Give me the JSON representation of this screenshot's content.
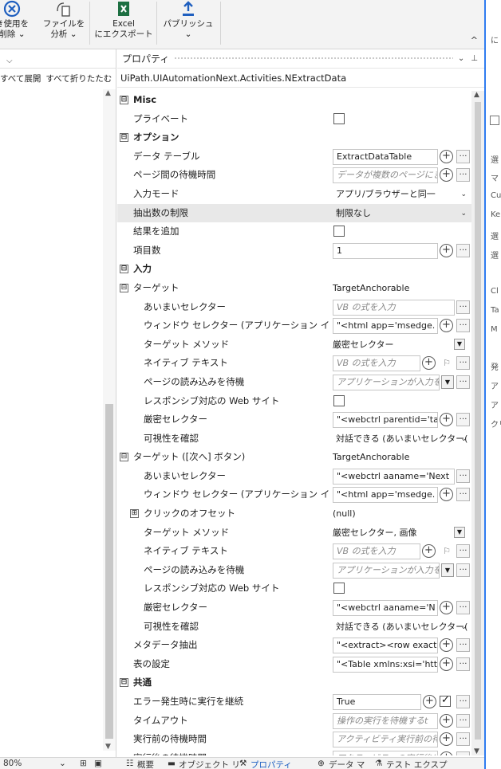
{
  "ribbon": {
    "btn1": {
      "icon": "close-circle-icon",
      "line1": "き使用を",
      "line2": "削除 ⌄"
    },
    "btn2": {
      "icon": "analyze-file-icon",
      "line1": "ファイルを",
      "line2": "分析 ⌄"
    },
    "btn3": {
      "icon": "excel-icon",
      "line1": "Excel",
      "line2": "にエクスポート"
    },
    "btn4": {
      "icon": "publish-icon",
      "line1": "パブリッシュ",
      "line2": "⌄"
    },
    "collapse": "^"
  },
  "left_panel": {
    "expand_all": "すべて展開",
    "collapse_all": "すべて折りたたむ"
  },
  "properties": {
    "title": "プロパティ",
    "activity": "UiPath.UIAutomationNext.Activities.NExtractData",
    "rows": [
      {
        "kind": "cat",
        "toggle": "⊟",
        "name": "Misc"
      },
      {
        "name": "プライベート",
        "value": {
          "type": "check",
          "checked": false
        }
      },
      {
        "kind": "cat",
        "toggle": "⊟",
        "name": "オプション"
      },
      {
        "name": "データ テーブル",
        "value": {
          "type": "text",
          "text": "ExtractDataTable",
          "add": true,
          "ell": true
        }
      },
      {
        "name": "ページ間の待機時間",
        "value": {
          "type": "text",
          "text": "データが複数のページにま",
          "ph": true,
          "add": true,
          "ell": true
        }
      },
      {
        "name": "入力モード",
        "value": {
          "type": "dropdown",
          "text": "アプリ/ブラウザーと同一"
        }
      },
      {
        "name": "抽出数の制限",
        "selected": true,
        "value": {
          "type": "dropdown",
          "text": "制限なし"
        }
      },
      {
        "name": "結果を追加",
        "value": {
          "type": "check",
          "checked": false
        }
      },
      {
        "name": "項目数",
        "value": {
          "type": "text",
          "text": "1",
          "add": true,
          "ell": true
        }
      },
      {
        "kind": "cat",
        "toggle": "⊟",
        "name": "入力"
      },
      {
        "kind": "sub",
        "toggle": "⊟",
        "name": "ターゲット",
        "value": {
          "type": "plain",
          "text": "TargetAnchorable"
        }
      },
      {
        "indent": 2,
        "name": "あいまいセレクター",
        "value": {
          "type": "text",
          "text": "VB の式を入力",
          "ph": true,
          "ell": true
        }
      },
      {
        "indent": 2,
        "name": "ウィンドウ セレクター (アプリケーション インスタン...",
        "value": {
          "type": "text",
          "text": "\"<html app='msedge.",
          "add": true,
          "ell": true
        }
      },
      {
        "indent": 2,
        "name": "ターゲット メソッド",
        "value": {
          "type": "plainsq",
          "text": "厳密セレクター"
        }
      },
      {
        "indent": 2,
        "name": "ネイティブ テキスト",
        "value": {
          "type": "text",
          "text": "VB の式を入力",
          "ph": true,
          "add": true,
          "flag": true,
          "ell": true
        }
      },
      {
        "indent": 2,
        "name": "ページの読み込みを待機",
        "value": {
          "type": "text",
          "text": "アプリケーションが入力を",
          "ph": true,
          "sqdd": true,
          "ell": true
        }
      },
      {
        "indent": 2,
        "name": "レスポンシブ対応の Web サイト",
        "value": {
          "type": "check",
          "checked": false
        }
      },
      {
        "indent": 2,
        "name": "厳密セレクター",
        "value": {
          "type": "text",
          "text": "\"<webctrl parentid='ta",
          "add": true,
          "ell": true
        }
      },
      {
        "indent": 2,
        "name": "可視性を確認",
        "value": {
          "type": "dropdown",
          "text": "対話できる (あいまいセレクター("
        }
      },
      {
        "kind": "sub",
        "toggle": "⊟",
        "name": "ターゲット ([次へ] ボタン)",
        "value": {
          "type": "plain",
          "text": "TargetAnchorable"
        }
      },
      {
        "indent": 2,
        "name": "あいまいセレクター",
        "value": {
          "type": "text",
          "text": "\"<webctrl aaname='Next",
          "ell": true
        }
      },
      {
        "indent": 2,
        "name": "ウィンドウ セレクター (アプリケーション インスタン...",
        "value": {
          "type": "text",
          "text": "\"<html app='msedge.",
          "add": true,
          "ell": true
        }
      },
      {
        "kind": "sub2",
        "toggle": "⊞",
        "name": "クリックのオフセット",
        "value": {
          "type": "plain",
          "text": "(null)"
        }
      },
      {
        "indent": 2,
        "name": "ターゲット メソッド",
        "value": {
          "type": "plainsq",
          "text": "厳密セレクター, 画像"
        }
      },
      {
        "indent": 2,
        "name": "ネイティブ テキスト",
        "value": {
          "type": "text",
          "text": "VB の式を入力",
          "ph": true,
          "add": true,
          "flag": true,
          "ell": true
        }
      },
      {
        "indent": 2,
        "name": "ページの読み込みを待機",
        "value": {
          "type": "text",
          "text": "アプリケーションが入力を",
          "ph": true,
          "sqdd": true,
          "ell": true
        }
      },
      {
        "indent": 2,
        "name": "レスポンシブ対応の Web サイト",
        "value": {
          "type": "check",
          "checked": false
        }
      },
      {
        "indent": 2,
        "name": "厳密セレクター",
        "value": {
          "type": "text",
          "text": "\"<webctrl aaname='N",
          "add": true,
          "ell": true
        }
      },
      {
        "indent": 2,
        "name": "可視性を確認",
        "value": {
          "type": "dropdown",
          "text": "対話できる (あいまいセレクター("
        }
      },
      {
        "indent": 1,
        "name": "メタデータ抽出",
        "value": {
          "type": "text",
          "text": "\"<extract><row exact",
          "add": true,
          "ell": true
        }
      },
      {
        "indent": 1,
        "name": "表の設定",
        "value": {
          "type": "text",
          "text": "\"<Table xmlns:xsi='htt",
          "add": true,
          "ell": true
        }
      },
      {
        "kind": "cat",
        "toggle": "⊟",
        "name": "共通"
      },
      {
        "indent": 1,
        "name": "エラー発生時に実行を継続",
        "value": {
          "type": "text",
          "text": "True",
          "add": true,
          "check": true,
          "ell": true
        }
      },
      {
        "indent": 1,
        "name": "タイムアウト",
        "value": {
          "type": "text",
          "text": "操作の実行を待機するt",
          "ph": true,
          "add": true,
          "ell": true
        }
      },
      {
        "indent": 1,
        "name": "実行前の待機時間",
        "value": {
          "type": "text",
          "text": "アクティビティ実行前の待",
          "ph": true,
          "add": true,
          "ell": true
        }
      },
      {
        "indent": 1,
        "name": "実行後の待機時間",
        "value": {
          "type": "text",
          "text": "アクティビティの実行後に",
          "ph": true,
          "add": true,
          "ell": true
        }
      }
    ]
  },
  "right_panel": {
    "labels": [
      "に",
      "選",
      "マ",
      "Cu",
      "Ke",
      "選",
      "選",
      "Cl",
      "Ta",
      "M",
      "発",
      "ア",
      "ア",
      "クリ"
    ]
  },
  "status": {
    "zoom": "80%",
    "zoom_dd": "⌄",
    "tabs": [
      {
        "label": "概要",
        "active": false
      },
      {
        "label": "オブジェクト リ",
        "active": false
      },
      {
        "label": "プロパティ",
        "active": true
      },
      {
        "label": "データ マ",
        "active": false
      },
      {
        "label": "テスト エクスプ",
        "active": false
      }
    ]
  }
}
